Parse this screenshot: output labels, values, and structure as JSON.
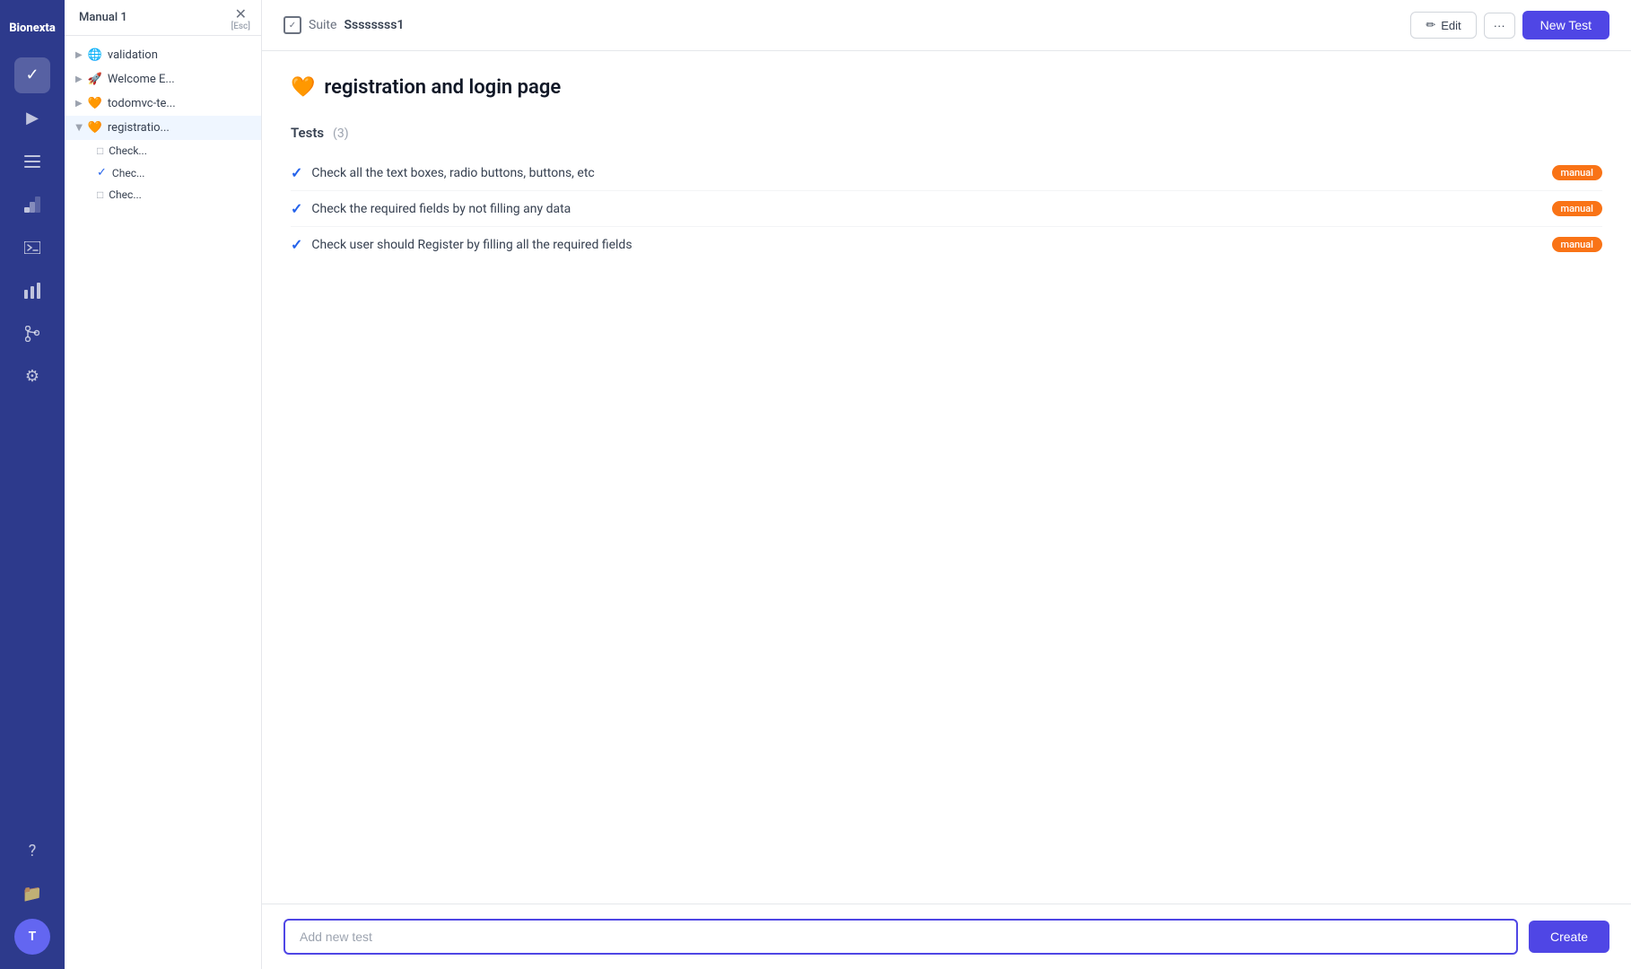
{
  "app": {
    "name": "Bionexta"
  },
  "nav": {
    "icons": [
      {
        "name": "check-icon",
        "symbol": "✓",
        "active": true
      },
      {
        "name": "play-icon",
        "symbol": "▶"
      },
      {
        "name": "list-check-icon",
        "symbol": "☰"
      },
      {
        "name": "stairs-icon",
        "symbol": "⚡"
      },
      {
        "name": "terminal-icon",
        "symbol": "⊞"
      },
      {
        "name": "chart-icon",
        "symbol": "▦"
      },
      {
        "name": "branch-icon",
        "symbol": "⑂"
      },
      {
        "name": "settings-icon",
        "symbol": "⚙"
      },
      {
        "name": "help-icon",
        "symbol": "?"
      },
      {
        "name": "folder-icon",
        "symbol": "⊟"
      }
    ]
  },
  "sidebar": {
    "header": "Manual 1",
    "close_label": "[Esc]",
    "items": [
      {
        "id": "validation",
        "emoji": "🌐",
        "label": "validation",
        "expanded": false
      },
      {
        "id": "welcome",
        "emoji": "🚀",
        "label": "Welcome E...",
        "expanded": false
      },
      {
        "id": "todomvc",
        "emoji": "🧡",
        "label": "todomvc-te...",
        "expanded": false
      },
      {
        "id": "registration",
        "emoji": "🧡",
        "label": "registratio...",
        "expanded": true
      }
    ],
    "sub_items": [
      {
        "id": "check1",
        "label": "Check...",
        "icon": "square",
        "checked": false
      },
      {
        "id": "check2",
        "label": "Chec...",
        "icon": "check",
        "checked": true
      },
      {
        "id": "check3",
        "label": "Chec...",
        "icon": "square",
        "checked": false
      }
    ]
  },
  "header": {
    "suite_label": "Suite",
    "suite_name": "Ssssssss1",
    "edit_label": "Edit",
    "more_label": "···",
    "new_test_label": "New Test"
  },
  "page": {
    "title_emoji": "🧡",
    "title": "registration and login page",
    "tests_label": "Tests",
    "tests_count": "(3)",
    "tests": [
      {
        "label": "Check all the text boxes, radio buttons, buttons, etc",
        "badge": "manual",
        "checked": true
      },
      {
        "label": "Check the required fields by not filling any data",
        "badge": "manual",
        "checked": true
      },
      {
        "label": "Check user should Register by filling all the required fields",
        "badge": "manual",
        "checked": true
      }
    ]
  },
  "bottom": {
    "input_placeholder": "Add new test",
    "create_label": "Create"
  }
}
